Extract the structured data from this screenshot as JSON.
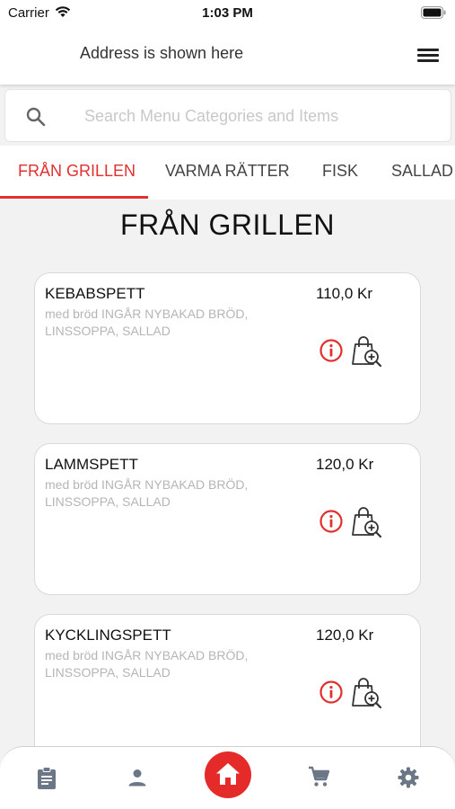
{
  "status_bar": {
    "carrier": "Carrier",
    "time": "1:03 PM"
  },
  "header": {
    "address": "Address is shown here",
    "menu_icon": "hamburger-icon"
  },
  "search": {
    "placeholder": "Search Menu Categories and Items",
    "value": "",
    "icon": "search-icon"
  },
  "tabs": [
    {
      "label": "FRÅN GRILLEN",
      "active": true
    },
    {
      "label": "VARMA RÄTTER",
      "active": false
    },
    {
      "label": "FISK",
      "active": false
    },
    {
      "label": "SALLAD",
      "active": false
    }
  ],
  "section_title": "FRÅN GRILLEN",
  "menu_items": [
    {
      "name": "KEBABSPETT",
      "description": "med bröd INGÅR NYBAKAD BRÖD, LINSSOPPA, SALLAD",
      "price": "110,0 Kr"
    },
    {
      "name": "LAMMSPETT",
      "description": "med bröd INGÅR NYBAKAD BRÖD, LINSSOPPA, SALLAD",
      "price": "120,0 Kr"
    },
    {
      "name": "KYCKLINGSPETT",
      "description": "med bröd INGÅR NYBAKAD BRÖD, LINSSOPPA, SALLAD",
      "price": "120,0 Kr"
    }
  ],
  "bottom_nav": {
    "items": [
      "orders-icon",
      "profile-icon",
      "home-icon",
      "cart-icon",
      "settings-icon"
    ],
    "active": "home-icon"
  },
  "colors": {
    "accent": "#e2302f",
    "home_button": "#e52a2a",
    "nav_icon": "#6b7787",
    "description_text": "#b5b5b5"
  }
}
